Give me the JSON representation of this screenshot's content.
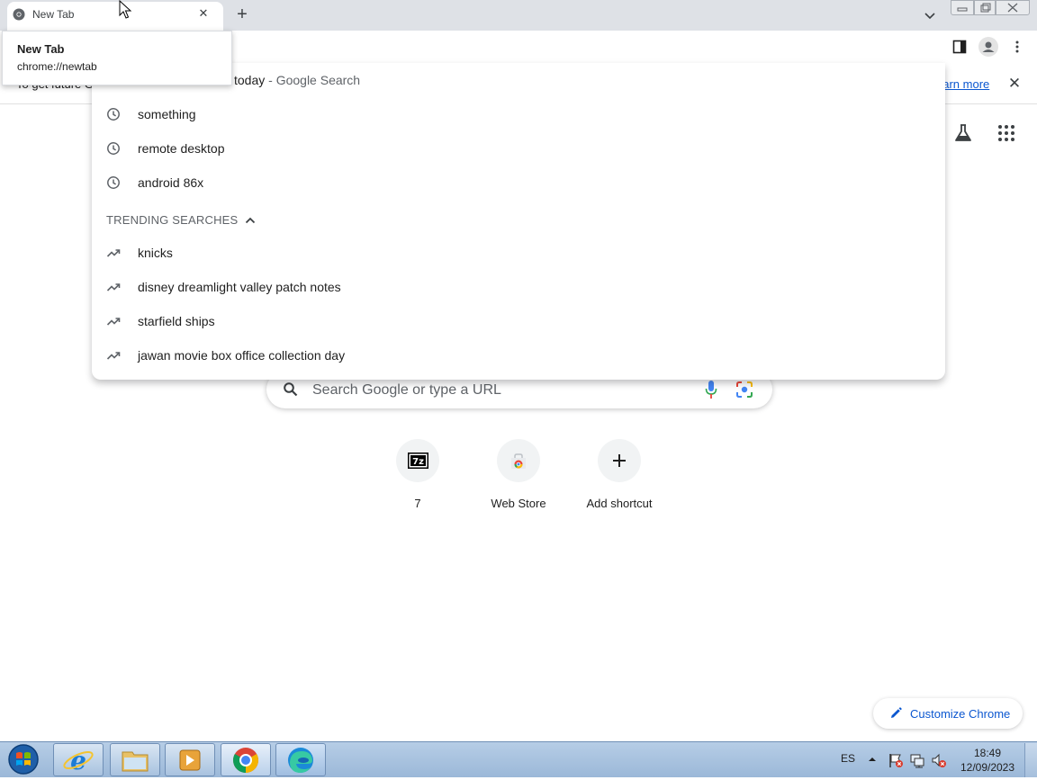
{
  "tab": {
    "title": "New Tab",
    "close_label": "✕",
    "new_tab_label": "+"
  },
  "hovercard": {
    "title": "New Tab",
    "url": "chrome://newtab"
  },
  "infobar": {
    "text": "To get future G",
    "link": "earn more",
    "close_label": "✕"
  },
  "omnibox": {
    "first_suggestion": {
      "text": "today",
      "suffix": " - Google Search"
    },
    "history": [
      {
        "text": "something",
        "icon": "history-clock-icon"
      },
      {
        "text": "remote desktop",
        "icon": "history-clock-icon"
      },
      {
        "text": "android 86x",
        "icon": "history-clock-icon"
      }
    ],
    "trending_header": "TRENDING SEARCHES",
    "trending": [
      {
        "text": "knicks",
        "icon": "trending-icon"
      },
      {
        "text": "disney dreamlight valley patch notes",
        "icon": "trending-icon"
      },
      {
        "text": "starfield ships",
        "icon": "trending-icon"
      },
      {
        "text": "jawan movie box office collection day",
        "icon": "trending-icon"
      }
    ]
  },
  "ntp": {
    "search_placeholder": "Search Google or type a URL",
    "shortcuts": [
      {
        "label": "7",
        "icon": "7zip-icon"
      },
      {
        "label": "Web Store",
        "icon": "web-store-icon"
      },
      {
        "label": "Add shortcut",
        "icon": "plus-icon"
      }
    ],
    "customize_label": "Customize Chrome"
  },
  "taskbar": {
    "language": "ES",
    "time": "18:49",
    "date": "12/09/2023"
  },
  "colors": {
    "accent": "#0b57d0",
    "tabstrip": "#dee1e6",
    "taskbar": "#b6cde6"
  }
}
